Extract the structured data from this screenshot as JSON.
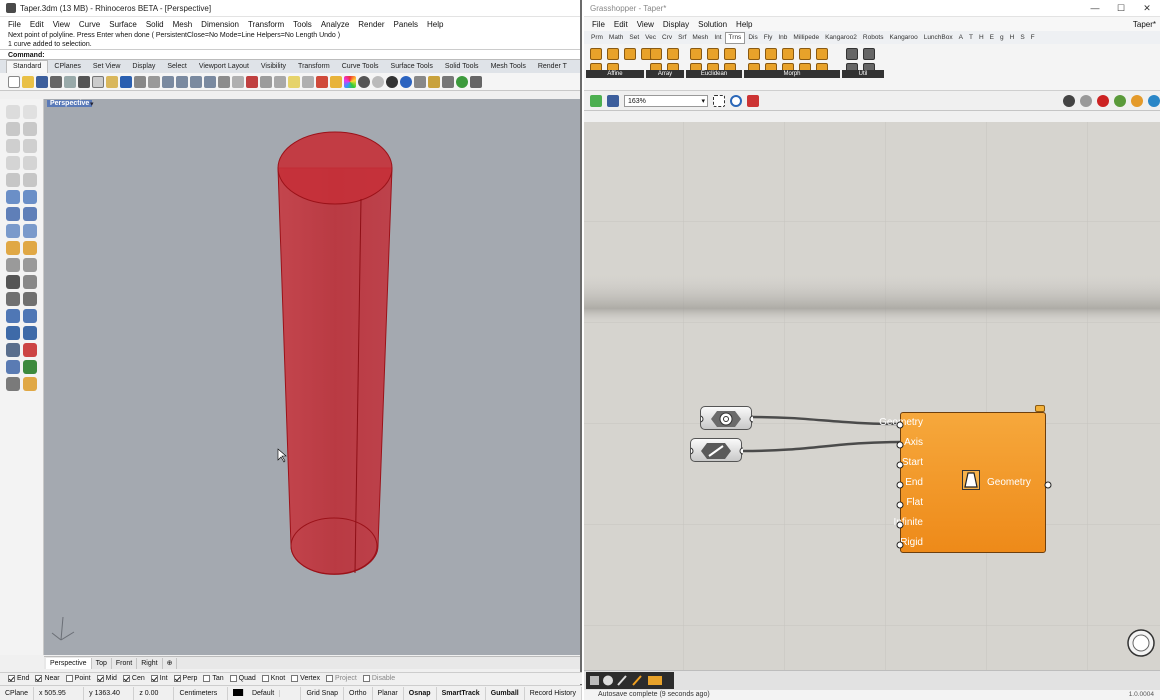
{
  "rhino": {
    "title": "Taper.3dm (13 MB) - Rhinoceros BETA - [Perspective]",
    "menu": [
      "File",
      "Edit",
      "View",
      "Curve",
      "Surface",
      "Solid",
      "Mesh",
      "Dimension",
      "Transform",
      "Tools",
      "Analyze",
      "Render",
      "Panels",
      "Help"
    ],
    "command_history": [
      "Next point of polyline. Press Enter when done ( PersistentClose=No  Mode=Line  Helpers=No  Length  Undo )",
      "1 curve added to selection."
    ],
    "command_prompt": "Command:",
    "toolbar_tabs": [
      "Standard",
      "CPlanes",
      "Set View",
      "Display",
      "Select",
      "Viewport Layout",
      "Visibility",
      "Transform",
      "Curve Tools",
      "Surface Tools",
      "Solid Tools",
      "Mesh Tools",
      "Render T"
    ],
    "active_toolbar_tab": "Standard",
    "viewport_label": "Perspective",
    "viewport_tabs": [
      "Perspective",
      "Top",
      "Front",
      "Right",
      "⊕"
    ],
    "osnaps": [
      {
        "label": "End",
        "checked": true
      },
      {
        "label": "Near",
        "checked": true
      },
      {
        "label": "Point",
        "checked": false
      },
      {
        "label": "Mid",
        "checked": true
      },
      {
        "label": "Cen",
        "checked": true
      },
      {
        "label": "Int",
        "checked": true
      },
      {
        "label": "Perp",
        "checked": true
      },
      {
        "label": "Tan",
        "checked": false
      },
      {
        "label": "Quad",
        "checked": false
      },
      {
        "label": "Knot",
        "checked": false
      },
      {
        "label": "Vertex",
        "checked": false
      },
      {
        "label": "Project",
        "checked": false
      },
      {
        "label": "Disable",
        "checked": false
      }
    ],
    "status": {
      "cplane": "CPlane",
      "x": "x 505.95",
      "y": "y 1363.40",
      "z": "z 0.00",
      "units": "Centimeters",
      "layer": "Default",
      "toggles": [
        "Grid Snap",
        "Ortho",
        "Planar",
        "Osnap",
        "SmartTrack",
        "Gumball",
        "Record History"
      ]
    },
    "colors": {
      "object_fill": "#c42a33",
      "viewport_bg": "#a4a9b0"
    }
  },
  "grasshopper": {
    "title": "Grasshopper - Taper*",
    "doc_name": "Taper*",
    "menu": [
      "File",
      "Edit",
      "View",
      "Display",
      "Solution",
      "Help"
    ],
    "tabs": [
      "Prm",
      "Math",
      "Set",
      "Vec",
      "Crv",
      "Srf",
      "Mesh",
      "Int",
      "Trns",
      "Dis",
      "Fly",
      "Inb",
      "Millipede",
      "Kangaroo2",
      "Robots",
      "Kangaroo",
      "LunchBox",
      "A",
      "T",
      "H",
      "E",
      "g",
      "H",
      "S",
      "F"
    ],
    "active_tab": "Trns",
    "ribbon_groups": [
      "Affine",
      "Array",
      "Euclidean",
      "Morph",
      "Util"
    ],
    "zoom": "163%",
    "component": {
      "inputs": [
        "Geometry",
        "Axis",
        "Start",
        "End",
        "Flat",
        "Infinite",
        "Rigid"
      ],
      "output": "Geometry",
      "icon": "taper-icon"
    },
    "autosave": "Autosave complete (9 seconds ago)",
    "version": "1.0.0004"
  }
}
